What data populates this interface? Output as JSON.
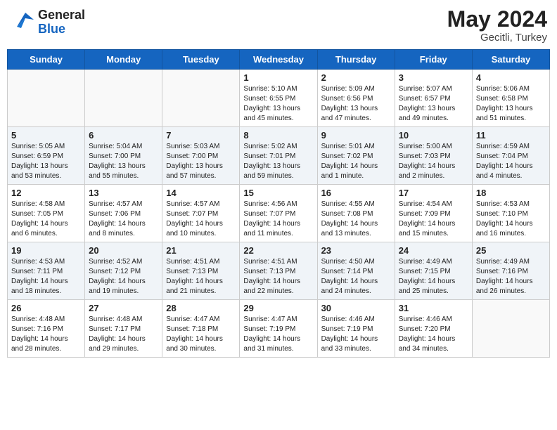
{
  "header": {
    "logo_general": "General",
    "logo_blue": "Blue",
    "month_year": "May 2024",
    "location": "Gecitli, Turkey"
  },
  "weekdays": [
    "Sunday",
    "Monday",
    "Tuesday",
    "Wednesday",
    "Thursday",
    "Friday",
    "Saturday"
  ],
  "weeks": [
    [
      {
        "day": "",
        "info": ""
      },
      {
        "day": "",
        "info": ""
      },
      {
        "day": "",
        "info": ""
      },
      {
        "day": "1",
        "info": "Sunrise: 5:10 AM\nSunset: 6:55 PM\nDaylight: 13 hours\nand 45 minutes."
      },
      {
        "day": "2",
        "info": "Sunrise: 5:09 AM\nSunset: 6:56 PM\nDaylight: 13 hours\nand 47 minutes."
      },
      {
        "day": "3",
        "info": "Sunrise: 5:07 AM\nSunset: 6:57 PM\nDaylight: 13 hours\nand 49 minutes."
      },
      {
        "day": "4",
        "info": "Sunrise: 5:06 AM\nSunset: 6:58 PM\nDaylight: 13 hours\nand 51 minutes."
      }
    ],
    [
      {
        "day": "5",
        "info": "Sunrise: 5:05 AM\nSunset: 6:59 PM\nDaylight: 13 hours\nand 53 minutes."
      },
      {
        "day": "6",
        "info": "Sunrise: 5:04 AM\nSunset: 7:00 PM\nDaylight: 13 hours\nand 55 minutes."
      },
      {
        "day": "7",
        "info": "Sunrise: 5:03 AM\nSunset: 7:00 PM\nDaylight: 13 hours\nand 57 minutes."
      },
      {
        "day": "8",
        "info": "Sunrise: 5:02 AM\nSunset: 7:01 PM\nDaylight: 13 hours\nand 59 minutes."
      },
      {
        "day": "9",
        "info": "Sunrise: 5:01 AM\nSunset: 7:02 PM\nDaylight: 14 hours\nand 1 minute."
      },
      {
        "day": "10",
        "info": "Sunrise: 5:00 AM\nSunset: 7:03 PM\nDaylight: 14 hours\nand 2 minutes."
      },
      {
        "day": "11",
        "info": "Sunrise: 4:59 AM\nSunset: 7:04 PM\nDaylight: 14 hours\nand 4 minutes."
      }
    ],
    [
      {
        "day": "12",
        "info": "Sunrise: 4:58 AM\nSunset: 7:05 PM\nDaylight: 14 hours\nand 6 minutes."
      },
      {
        "day": "13",
        "info": "Sunrise: 4:57 AM\nSunset: 7:06 PM\nDaylight: 14 hours\nand 8 minutes."
      },
      {
        "day": "14",
        "info": "Sunrise: 4:57 AM\nSunset: 7:07 PM\nDaylight: 14 hours\nand 10 minutes."
      },
      {
        "day": "15",
        "info": "Sunrise: 4:56 AM\nSunset: 7:07 PM\nDaylight: 14 hours\nand 11 minutes."
      },
      {
        "day": "16",
        "info": "Sunrise: 4:55 AM\nSunset: 7:08 PM\nDaylight: 14 hours\nand 13 minutes."
      },
      {
        "day": "17",
        "info": "Sunrise: 4:54 AM\nSunset: 7:09 PM\nDaylight: 14 hours\nand 15 minutes."
      },
      {
        "day": "18",
        "info": "Sunrise: 4:53 AM\nSunset: 7:10 PM\nDaylight: 14 hours\nand 16 minutes."
      }
    ],
    [
      {
        "day": "19",
        "info": "Sunrise: 4:53 AM\nSunset: 7:11 PM\nDaylight: 14 hours\nand 18 minutes."
      },
      {
        "day": "20",
        "info": "Sunrise: 4:52 AM\nSunset: 7:12 PM\nDaylight: 14 hours\nand 19 minutes."
      },
      {
        "day": "21",
        "info": "Sunrise: 4:51 AM\nSunset: 7:13 PM\nDaylight: 14 hours\nand 21 minutes."
      },
      {
        "day": "22",
        "info": "Sunrise: 4:51 AM\nSunset: 7:13 PM\nDaylight: 14 hours\nand 22 minutes."
      },
      {
        "day": "23",
        "info": "Sunrise: 4:50 AM\nSunset: 7:14 PM\nDaylight: 14 hours\nand 24 minutes."
      },
      {
        "day": "24",
        "info": "Sunrise: 4:49 AM\nSunset: 7:15 PM\nDaylight: 14 hours\nand 25 minutes."
      },
      {
        "day": "25",
        "info": "Sunrise: 4:49 AM\nSunset: 7:16 PM\nDaylight: 14 hours\nand 26 minutes."
      }
    ],
    [
      {
        "day": "26",
        "info": "Sunrise: 4:48 AM\nSunset: 7:16 PM\nDaylight: 14 hours\nand 28 minutes."
      },
      {
        "day": "27",
        "info": "Sunrise: 4:48 AM\nSunset: 7:17 PM\nDaylight: 14 hours\nand 29 minutes."
      },
      {
        "day": "28",
        "info": "Sunrise: 4:47 AM\nSunset: 7:18 PM\nDaylight: 14 hours\nand 30 minutes."
      },
      {
        "day": "29",
        "info": "Sunrise: 4:47 AM\nSunset: 7:19 PM\nDaylight: 14 hours\nand 31 minutes."
      },
      {
        "day": "30",
        "info": "Sunrise: 4:46 AM\nSunset: 7:19 PM\nDaylight: 14 hours\nand 33 minutes."
      },
      {
        "day": "31",
        "info": "Sunrise: 4:46 AM\nSunset: 7:20 PM\nDaylight: 14 hours\nand 34 minutes."
      },
      {
        "day": "",
        "info": ""
      }
    ]
  ]
}
